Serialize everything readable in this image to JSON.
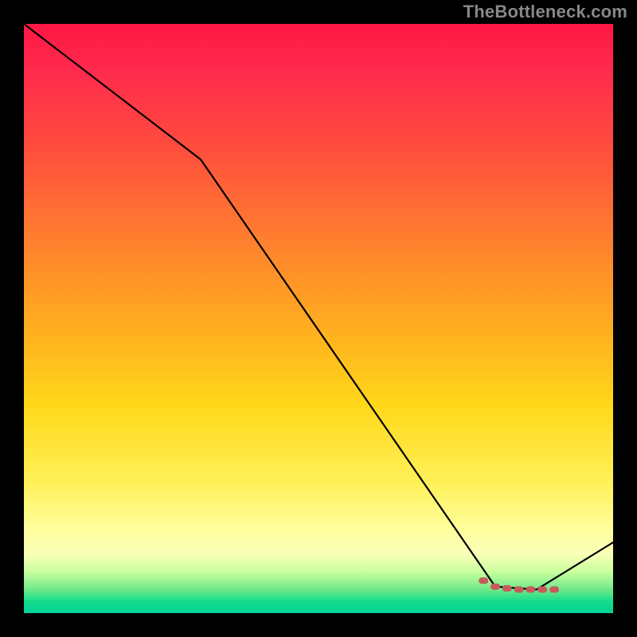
{
  "watermark": "TheBottleneck.com",
  "chart_data": {
    "type": "line",
    "title": "",
    "xlabel": "",
    "ylabel": "",
    "xlim": [
      0,
      100
    ],
    "ylim": [
      0,
      100
    ],
    "grid": false,
    "legend": false,
    "series": [
      {
        "name": "black-line",
        "color": "#000000",
        "x": [
          0,
          30,
          80,
          87,
          100
        ],
        "values": [
          100,
          77,
          4.5,
          4,
          12
        ]
      },
      {
        "name": "red-dotted-segment",
        "color": "#c75a5a",
        "style": "dotted",
        "x": [
          78,
          80,
          82,
          84,
          86,
          88,
          90
        ],
        "values": [
          5.5,
          4.5,
          4.2,
          4.0,
          4.0,
          4.0,
          4.0
        ]
      }
    ]
  }
}
